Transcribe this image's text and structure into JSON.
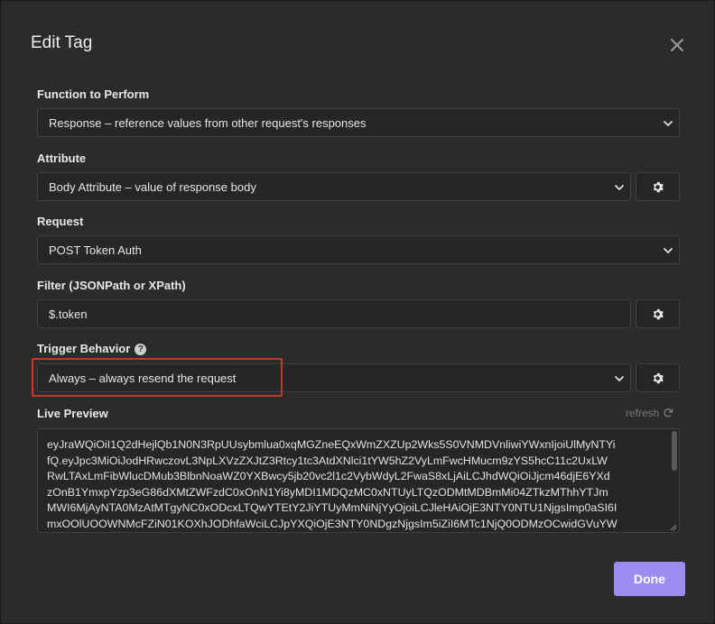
{
  "dialog": {
    "title": "Edit Tag",
    "close_icon": "close-icon"
  },
  "function": {
    "label": "Function to Perform",
    "value": "Response – reference values from other request's responses"
  },
  "attribute": {
    "label": "Attribute",
    "value": "Body Attribute – value of response body",
    "settings_icon": "gear-icon"
  },
  "request": {
    "label": "Request",
    "value": "POST Token Auth"
  },
  "filter": {
    "label": "Filter (JSONPath or XPath)",
    "value": "$.token",
    "settings_icon": "gear-icon"
  },
  "trigger": {
    "label": "Trigger Behavior",
    "help_icon": "?",
    "value": "Always – always resend the request",
    "settings_icon": "gear-icon",
    "highlight_color": "#c0392b"
  },
  "preview": {
    "label": "Live Preview",
    "refresh_label": "refresh",
    "lines": [
      "eyJraWQiOiI1Q2dHejlQb1N0N3RpUUsybmlua0xqMGZneEQxWmZXZUp2Wks5S0VNMDVnliwiYWxnIjoiUlMyNTYi",
      "fQ.eyJpc3MiOiJodHRwczovL3NpLXVzZXJtZ3Rtcy1tc3AtdXNlci1tYW5hZ2VyLmFwcHMucm9zYS5hcC11c2UxLW",
      "RwLTAxLmFibWlucDMub3BlbnNoaWZ0YXBwcy5jb20vc2l1c2VybWdyL2FwaS8xLjAiLCJhdWQiOiJjcm46djE6YXd",
      "zOnB1YmxpYzp3eG86dXMtZWFzdC0xOnN1Yi8yMDI1MDQzMC0xNTUyLTQzODMtMDBmMi04ZTkzMThhYTJm",
      "MWI6MjAyNTA0MzAtMTgyNC0xODcxLTQwYTEtY2JiYTUyMmNiNjYyOjoiLCJleHAiOjE3NTY0NTU1NjgsImp0aSI6I",
      "mxOOlUOOWNMcFZiN01KOXhJODhfaWciLCJpYXQiOjE3NTY0NDgzNjgsIm5iZiI6MTc1NjQ0ODMzOCwidGVuYW"
    ]
  },
  "footer": {
    "done_label": "Done",
    "accent": "#9b8cf0"
  }
}
